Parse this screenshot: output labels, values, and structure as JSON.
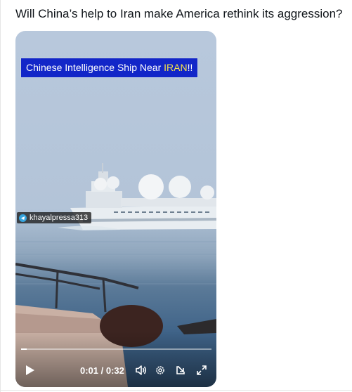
{
  "post": {
    "text": "Will China’s help to Iran make America rethink its aggression?"
  },
  "video": {
    "banner_prefix": "Chinese Intelligence Ship Near ",
    "banner_highlight": "IRAN",
    "banner_suffix": "!!",
    "banner_highlight_color": "#f6e34a",
    "banner_color": "#1226c8",
    "watermark": "khayalpressa313",
    "watermark_icon": "telegram-icon",
    "time_current": "0:01",
    "time_separator": " / ",
    "time_total": "0:32",
    "progress": 0.03,
    "controls": {
      "play_icon": "play-icon",
      "volume_icon": "volume-icon",
      "settings_icon": "settings-gear-icon",
      "popout_icon": "popout-icon",
      "fullscreen_icon": "fullscreen-icon"
    }
  }
}
